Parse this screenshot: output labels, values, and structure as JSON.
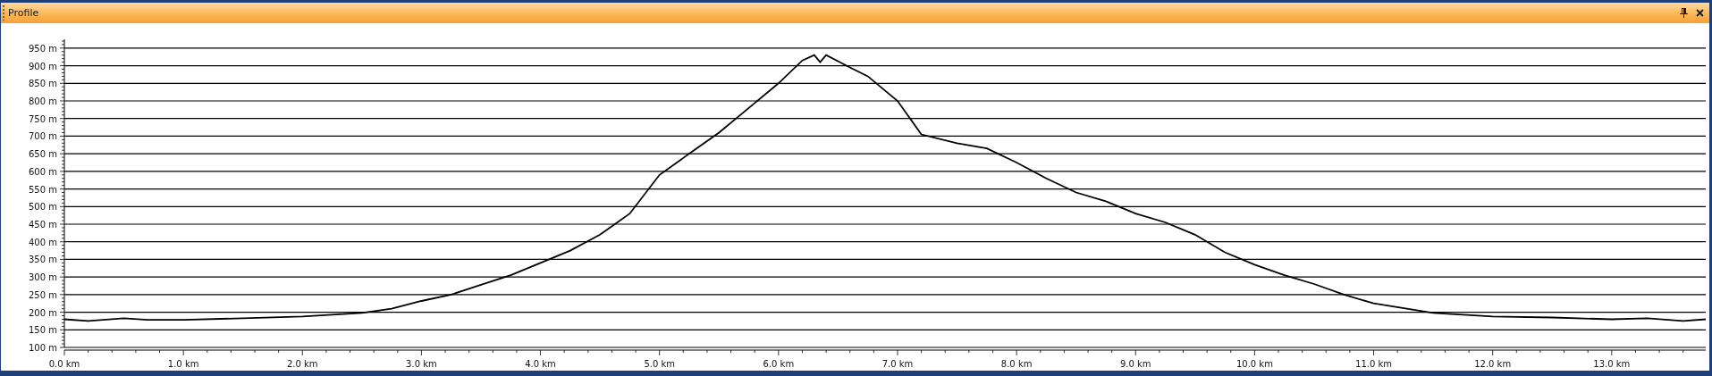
{
  "panel": {
    "title": "Profile",
    "chart_data": {
      "type": "line",
      "grid": true,
      "xlim": [
        0,
        13.79
      ],
      "ylim": [
        100,
        975
      ],
      "x": [
        0,
        0.2,
        0.5,
        0.7,
        1.0,
        1.5,
        2.0,
        2.5,
        2.75,
        3.0,
        3.25,
        3.5,
        3.75,
        4.0,
        4.25,
        4.5,
        4.75,
        5.0,
        5.25,
        5.5,
        5.75,
        6.0,
        6.2,
        6.3,
        6.35,
        6.4,
        6.6,
        6.75,
        7.0,
        7.2,
        7.5,
        7.75,
        8.0,
        8.25,
        8.5,
        8.75,
        9.0,
        9.25,
        9.5,
        9.75,
        10.0,
        10.25,
        10.5,
        10.75,
        11.0,
        11.5,
        12.0,
        12.5,
        13.0,
        13.3,
        13.6,
        13.79
      ],
      "series": [
        {
          "color": "#000000",
          "values": [
            180,
            175,
            183,
            178,
            178,
            183,
            188,
            198,
            210,
            232,
            250,
            278,
            305,
            340,
            375,
            420,
            480,
            590,
            650,
            710,
            780,
            850,
            915,
            930,
            910,
            930,
            895,
            870,
            800,
            705,
            680,
            665,
            625,
            580,
            540,
            515,
            480,
            455,
            420,
            370,
            335,
            305,
            280,
            250,
            225,
            198,
            188,
            185,
            180,
            183,
            175,
            180
          ]
        }
      ],
      "xticks": [
        {
          "value": 0,
          "label": "0.0 km"
        },
        {
          "value": 1,
          "label": "1.0 km"
        },
        {
          "value": 2,
          "label": "2.0 km"
        },
        {
          "value": 3,
          "label": "3.0 km"
        },
        {
          "value": 4,
          "label": "4.0 km"
        },
        {
          "value": 5,
          "label": "5.0 km"
        },
        {
          "value": 6,
          "label": "6.0 km"
        },
        {
          "value": 7,
          "label": "7.0 km"
        },
        {
          "value": 8,
          "label": "8.0 km"
        },
        {
          "value": 9,
          "label": "9.0 km"
        },
        {
          "value": 10,
          "label": "10.0 km"
        },
        {
          "value": 11,
          "label": "11.0 km"
        },
        {
          "value": 12,
          "label": "12.0 km"
        },
        {
          "value": 13,
          "label": "13.0 km"
        }
      ],
      "yticks": [
        {
          "value": 100,
          "label": "100 m"
        },
        {
          "value": 150,
          "label": "150 m"
        },
        {
          "value": 200,
          "label": "200 m"
        },
        {
          "value": 250,
          "label": "250 m"
        },
        {
          "value": 300,
          "label": "300 m"
        },
        {
          "value": 350,
          "label": "350 m"
        },
        {
          "value": 400,
          "label": "400 m"
        },
        {
          "value": 450,
          "label": "450 m"
        },
        {
          "value": 500,
          "label": "500 m"
        },
        {
          "value": 550,
          "label": "550 m"
        },
        {
          "value": 600,
          "label": "600 m"
        },
        {
          "value": 650,
          "label": "650 m"
        },
        {
          "value": 700,
          "label": "700 m"
        },
        {
          "value": 750,
          "label": "750 m"
        },
        {
          "value": 800,
          "label": "800 m"
        },
        {
          "value": 850,
          "label": "850 m"
        },
        {
          "value": 900,
          "label": "900 m"
        },
        {
          "value": 950,
          "label": "950 m"
        }
      ]
    }
  }
}
